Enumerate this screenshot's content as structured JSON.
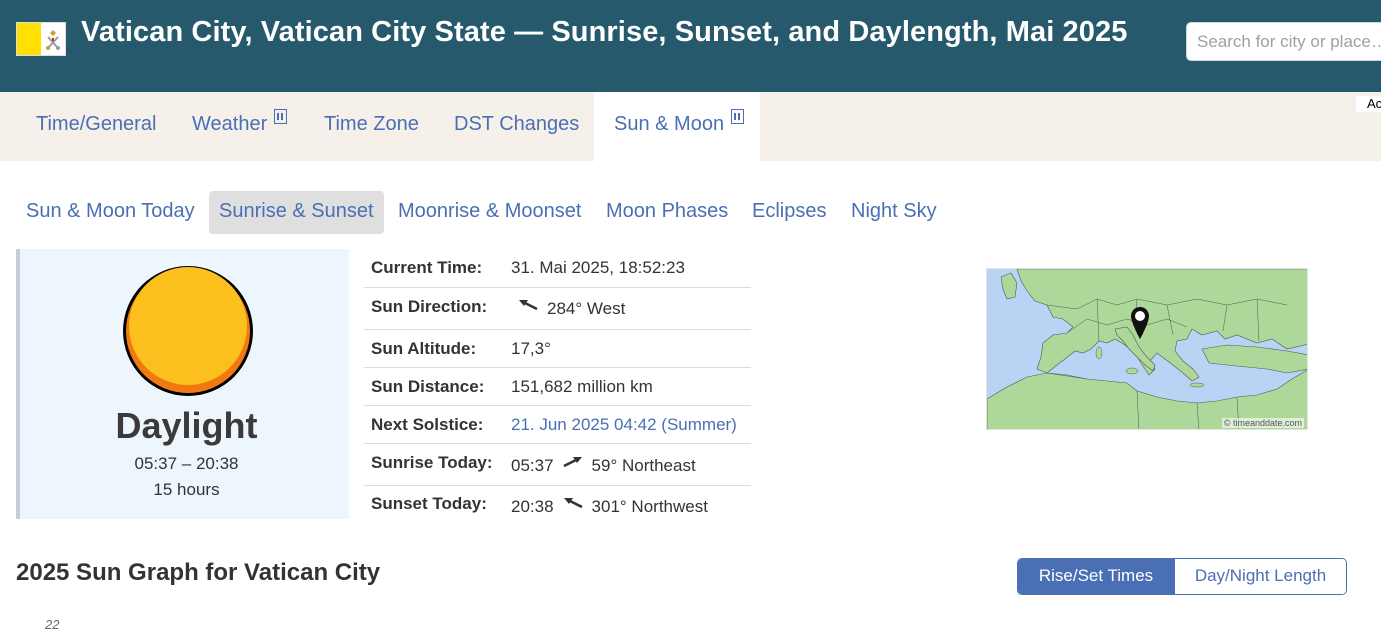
{
  "header": {
    "title": "Vatican City, Vatican City State — Sunrise, Sunset, and Daylength, Mai 2025",
    "flag_icon": "vatican-flag-icon",
    "search_placeholder": "Search for city or place…"
  },
  "nav": {
    "items": [
      {
        "label": "Time/General"
      },
      {
        "label": "Weather",
        "icon": "ext-menu-icon"
      },
      {
        "label": "Time Zone"
      },
      {
        "label": "DST Changes"
      },
      {
        "label": "Sun & Moon",
        "icon": "ext-menu-icon",
        "active": true
      }
    ],
    "ad_label": "Ac"
  },
  "subnav": {
    "items": [
      {
        "label": "Sun & Moon Today"
      },
      {
        "label": "Sunrise & Sunset",
        "active": true
      },
      {
        "label": "Moonrise & Moonset"
      },
      {
        "label": "Moon Phases"
      },
      {
        "label": "Eclipses"
      },
      {
        "label": "Night Sky"
      }
    ]
  },
  "daylight": {
    "label": "Daylight",
    "times": "05:37 – 20:38",
    "hours": "15 hours"
  },
  "info": {
    "rows": [
      {
        "key": "Current Time:",
        "value": "31. Mai 2025, 18:52:23"
      },
      {
        "key": "Sun Direction:",
        "value": "284° West",
        "arrow_icon": "direction-arrow-west-icon"
      },
      {
        "key": "Sun Altitude:",
        "value": "17,3°"
      },
      {
        "key": "Sun Distance:",
        "value": "151,682 million km"
      },
      {
        "key": "Next Solstice:",
        "value": "21. Jun 2025 04:42 (Summer)"
      },
      {
        "key": "Sunrise Today:",
        "time": "05:37",
        "value": "59° Northeast",
        "arrow_icon": "direction-arrow-northeast-icon"
      },
      {
        "key": "Sunset Today:",
        "time": "20:38",
        "value": "301° Northwest",
        "arrow_icon": "direction-arrow-northwest-icon"
      }
    ]
  },
  "map": {
    "credit": "© timeanddate.com",
    "pin_icon": "location-pin-icon"
  },
  "graph": {
    "title": "2025 Sun Graph for Vatican City",
    "toggle_on": "Rise/Set Times",
    "toggle_off": "Day/Night Length",
    "first_tick": "22"
  },
  "colors": {
    "header_bg": "#25596b",
    "nav_bg": "#f5f1ea",
    "link": "#4a6fb4",
    "sun": "#fbbf1e",
    "sun_shadow": "#f07a10"
  }
}
